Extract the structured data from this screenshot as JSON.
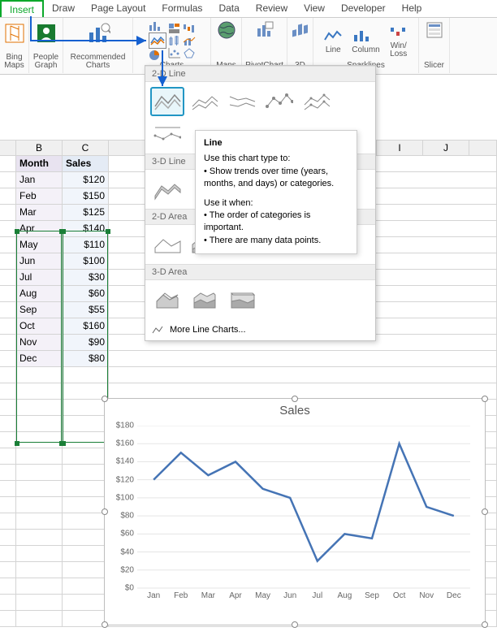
{
  "tabs": [
    "Insert",
    "Draw",
    "Page Layout",
    "Formulas",
    "Data",
    "Review",
    "View",
    "Developer",
    "Help"
  ],
  "active_tab": 0,
  "ribbon": {
    "bing": "Bing\nMaps",
    "people": "People\nGraph",
    "recommended": "Recommended\nCharts",
    "charts": "Charts",
    "maps": "Maps",
    "pivot": "PivotChart",
    "threeD": "3D",
    "line": "Line",
    "column": "Column",
    "winloss": "Win/\nLoss",
    "sparklines": "Sparklines",
    "slicer": "Slicer"
  },
  "columns": [
    "B",
    "C",
    "I",
    "J"
  ],
  "table": {
    "headers": [
      "Month",
      "Sales"
    ],
    "rows": [
      [
        "Jan",
        "$120"
      ],
      [
        "Feb",
        "$150"
      ],
      [
        "Mar",
        "$125"
      ],
      [
        "Apr",
        "$140"
      ],
      [
        "May",
        "$110"
      ],
      [
        "Jun",
        "$100"
      ],
      [
        "Jul",
        "$30"
      ],
      [
        "Aug",
        "$60"
      ],
      [
        "Sep",
        "$55"
      ],
      [
        "Oct",
        "$160"
      ],
      [
        "Nov",
        "$90"
      ],
      [
        "Dec",
        "$80"
      ]
    ]
  },
  "dropdown": {
    "sec1": "2-D Line",
    "sec2": "3-D Line",
    "sec3": "2-D Area",
    "sec4": "3-D Area",
    "more": "More Line Charts..."
  },
  "tooltip": {
    "title": "Line",
    "intro": "Use this chart type to:",
    "b1": "• Show trends over time (years, months, and days) or categories.",
    "intro2": "Use it when:",
    "b2": "• The order of categories is important.",
    "b3": "• There are many data points."
  },
  "chart_data": {
    "type": "line",
    "title": "Sales",
    "categories": [
      "Jan",
      "Feb",
      "Mar",
      "Apr",
      "May",
      "Jun",
      "Jul",
      "Aug",
      "Sep",
      "Oct",
      "Nov",
      "Dec"
    ],
    "values": [
      120,
      150,
      125,
      140,
      110,
      100,
      30,
      60,
      55,
      160,
      90,
      80
    ],
    "ylabel": "",
    "xlabel": "",
    "ylim": [
      0,
      180
    ],
    "yticks": [
      0,
      20,
      40,
      60,
      80,
      100,
      120,
      140,
      160,
      180
    ],
    "yticklabels": [
      "$0",
      "$20",
      "$40",
      "$60",
      "$80",
      "$100",
      "$120",
      "$140",
      "$160",
      "$180"
    ]
  }
}
